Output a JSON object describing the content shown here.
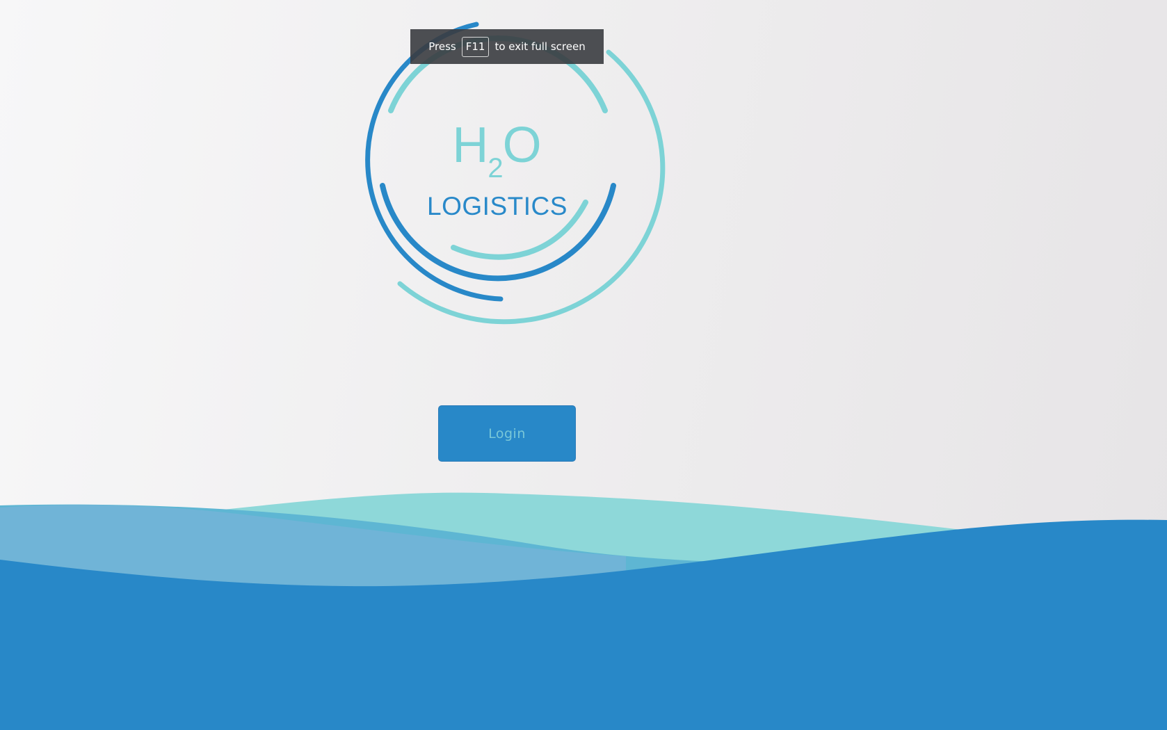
{
  "logo": {
    "h_letter": "H",
    "subscript": "2",
    "o_letter": "O",
    "company": "LOGISTICS"
  },
  "fullscreen_notice": {
    "prefix": "Press",
    "key": "F11",
    "suffix": "to exit full screen"
  },
  "login": {
    "label": "Login"
  },
  "colors": {
    "primary_blue": "#2888c8",
    "accent_teal": "#7dd3d6",
    "button_text": "#79c7d8"
  }
}
